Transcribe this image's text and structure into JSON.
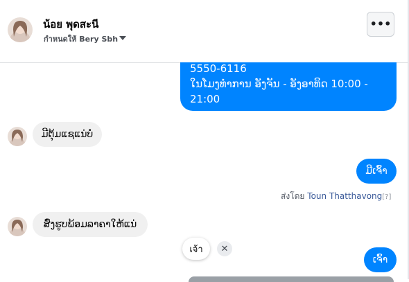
{
  "header": {
    "name": "น้อย พุดสะนี",
    "assigned": "กำหนดให้ Bery Sbh",
    "more_label": "•••"
  },
  "messages": {
    "outgoing_info": {
      "line1": "5550-6116",
      "line2": "ໃນໂມງທຳການ ອັງຈັນ - ອັງອາທິດ  10:00 -",
      "line3": "21:00"
    },
    "incoming_1": "ມີຕຸ້ມແຊແນ່ບໍ່",
    "outgoing_1": "ມີເຈົ້າ",
    "sent_by": {
      "prefix": "ส่งโดย ",
      "author": "Toun Thatthavong",
      "help": "[?]"
    },
    "incoming_2": "ສົ່ງຮູບພ້ອມລາຄາໃຫ້ແນ່",
    "outgoing_2": "ເຈົ້າ"
  },
  "quick_reply": {
    "label": "เจ้า",
    "dismiss": "✕"
  },
  "colors": {
    "accent": "#0084ff",
    "incoming_bg": "#f0f0f0"
  }
}
